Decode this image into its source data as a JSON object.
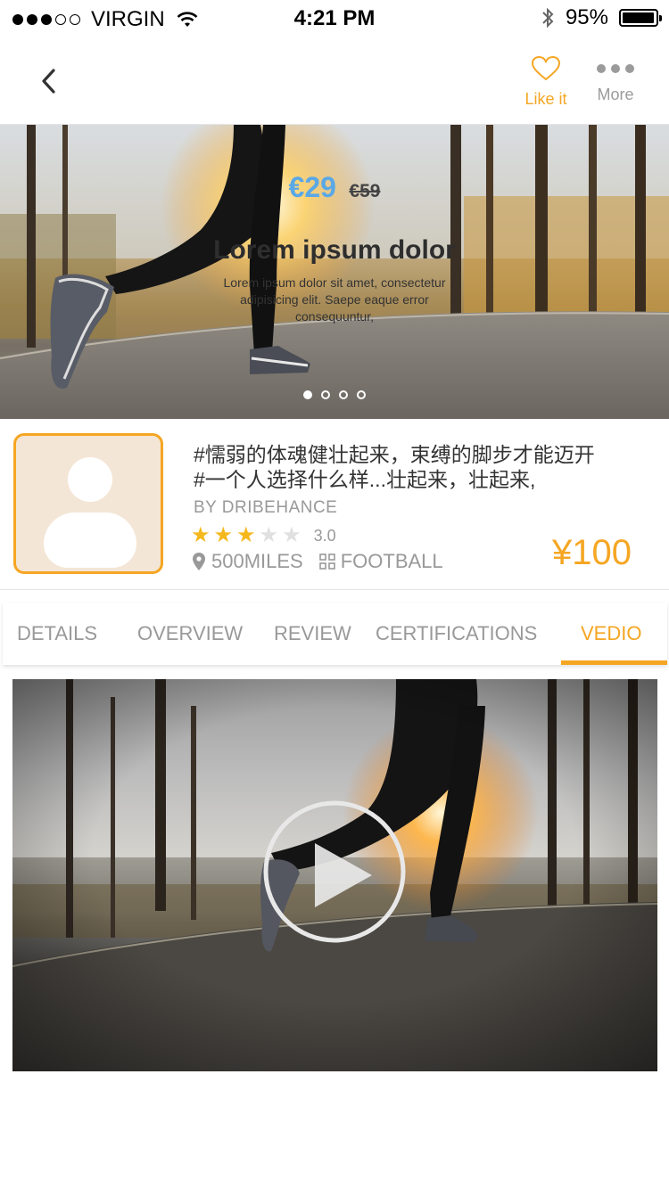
{
  "status_bar": {
    "carrier": "VIRGIN",
    "signal_bars": 5,
    "signal_filled": 3,
    "time": "4:21 PM",
    "battery_percent": "95%",
    "battery_level": 0.95
  },
  "nav": {
    "like_label": "Like it",
    "more_label": "More",
    "accent_color": "#f5a623"
  },
  "hero": {
    "price": "€29",
    "old_price": "€59",
    "title": "Lorem ipsum dolor",
    "description": "Lorem ipsum dolor sit amet, consectetur adipisicing elit. Saepe eaque error consequuntur,",
    "slides": 4,
    "active_slide": 0
  },
  "product": {
    "title_line1": "#懦弱的体魂健壮起来，束缚的脚步才能迈开",
    "title_line2": "#一个人选择什么样...壮起来，壮起来,",
    "author": "BY DRIBEHANCE",
    "stars_total": 5,
    "stars_filled": 3,
    "rating": "3.0",
    "distance": "500MILES",
    "category": "FOOTBALL",
    "price": "¥100"
  },
  "tabs": [
    {
      "label": "DETAILS"
    },
    {
      "label": "OVERVIEW"
    },
    {
      "label": "REVIEW"
    },
    {
      "label": "CERTIFICATIONS"
    },
    {
      "label": "VEDIO"
    }
  ],
  "active_tab": "VEDIO",
  "icons": {
    "back": "chevron-left-icon",
    "like": "heart-icon",
    "more": "more-dots-icon",
    "location": "location-pin-icon",
    "category": "grid-icon",
    "play": "play-icon"
  }
}
